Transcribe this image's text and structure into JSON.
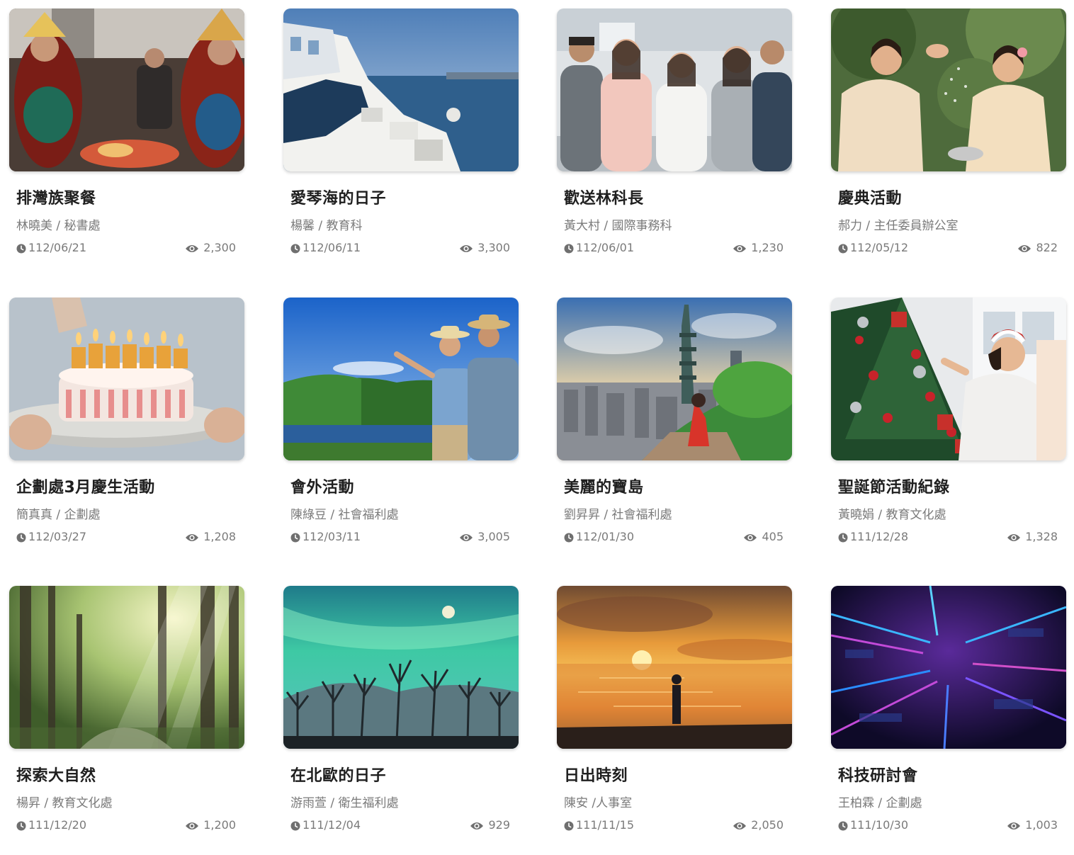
{
  "cards": [
    {
      "title": "排灣族聚餐",
      "author": "林曉美 / 秘書處",
      "date": "112/06/21",
      "views": "2,300",
      "scene": "festival"
    },
    {
      "title": "愛琴海的日子",
      "author": "楊馨 / 教育科",
      "date": "112/06/11",
      "views": "3,300",
      "scene": "santorini"
    },
    {
      "title": "歡送林科長",
      "author": "黃大村 / 國際事務科",
      "date": "112/06/01",
      "views": "1,230",
      "scene": "team"
    },
    {
      "title": "慶典活動",
      "author": "郝力 / 主任委員辦公室",
      "date": "112/05/12",
      "views": "822",
      "scene": "celebration"
    },
    {
      "title": "企劃處3月慶生活動",
      "author": "簡真真 / 企劃處",
      "date": "112/03/27",
      "views": "1,208",
      "scene": "birthday"
    },
    {
      "title": "會外活動",
      "author": "陳綠豆 / 社會福利處",
      "date": "112/03/11",
      "views": "3,005",
      "scene": "hiking"
    },
    {
      "title": "美麗的寶島",
      "author": "劉昇昇 / 社會福利處",
      "date": "112/01/30",
      "views": "405",
      "scene": "taipei"
    },
    {
      "title": "聖誕節活動紀錄",
      "author": "黃曉娟 / 教育文化處",
      "date": "111/12/28",
      "views": "1,328",
      "scene": "christmas"
    },
    {
      "title": "探索大自然",
      "author": "楊昇 / 教育文化處",
      "date": "111/12/20",
      "views": "1,200",
      "scene": "forest"
    },
    {
      "title": "在北歐的日子",
      "author": "游雨萱 / 衛生福利處",
      "date": "111/12/04",
      "views": "929",
      "scene": "aurora"
    },
    {
      "title": "日出時刻",
      "author": "陳安 /人事室",
      "date": "111/11/15",
      "views": "2,050",
      "scene": "sunrise"
    },
    {
      "title": "科技研討會",
      "author": "王柏霖 / 企劃處",
      "date": "111/10/30",
      "views": "1,003",
      "scene": "tech"
    }
  ],
  "icons": {
    "date": "clock-icon",
    "views": "eye-icon"
  },
  "colors": {
    "meta_text": "#7a7a7a",
    "title_text": "#1f1f1f"
  }
}
